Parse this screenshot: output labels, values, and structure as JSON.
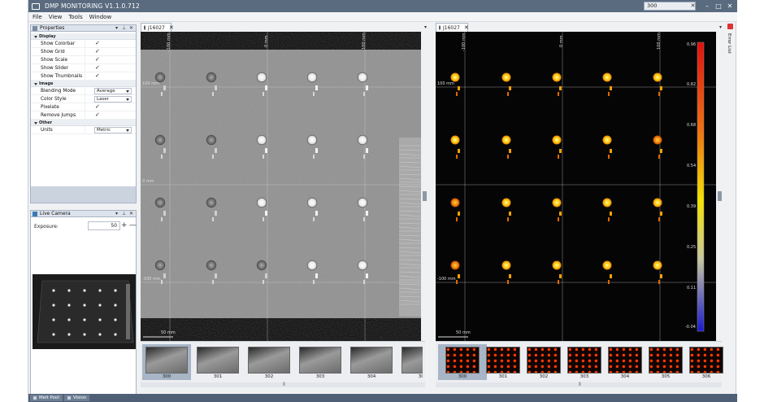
{
  "app": {
    "title": "DMP MONITORING V1.1.0.712",
    "search_value": "300",
    "search_clear": "✕",
    "minimize": "–",
    "maximize": "□",
    "close": "✕"
  },
  "menu": [
    "File",
    "View",
    "Tools",
    "Window"
  ],
  "properties": {
    "title": "Properties",
    "categories": {
      "display": "Display",
      "image": "Image",
      "other": "Other"
    },
    "display_rows": [
      {
        "label": "Show Colorbar",
        "checked": "✓"
      },
      {
        "label": "Show Grid",
        "checked": "✓"
      },
      {
        "label": "Show Scale",
        "checked": "✓"
      },
      {
        "label": "Show Slider",
        "checked": "✓"
      },
      {
        "label": "Show Thumbnails",
        "checked": "✓"
      }
    ],
    "image_rows": {
      "blending_label": "Blending Mode",
      "blending_value": "Average",
      "color_label": "Color Style",
      "color_value": "Laser",
      "pixelate_label": "Pixelate",
      "pixelate_checked": "✓",
      "jumps_label": "Remove Jumps",
      "jumps_checked": "✓"
    },
    "other_rows": {
      "units_label": "Units",
      "units_value": "Metric"
    }
  },
  "live_camera": {
    "title": "Live Camera",
    "exposure_label": "Exposure:",
    "exposure_value": "50",
    "plus": "+",
    "minus": "—"
  },
  "left_viewer": {
    "tab_label": "J16027",
    "top_ticks": [
      "-100 mm",
      "0 mm",
      "100 mm"
    ],
    "side_ticks": [
      "100 mm",
      "0 mm",
      "-100 mm"
    ],
    "scale_label": "50 mm",
    "thumbnails": [
      "300",
      "301",
      "302",
      "303",
      "304",
      "305"
    ],
    "selected_thumbnail": "300"
  },
  "right_viewer": {
    "tab_label": "J16027",
    "top_ticks": [
      "-100 mm",
      "0 mm",
      "100 mm"
    ],
    "side_ticks": [
      "100 mm",
      "0 mm",
      "-100 mm"
    ],
    "scale_label": "50 mm",
    "colorbar_ticks": [
      "0.96",
      "0.82",
      "0.68",
      "0.54",
      "0.39",
      "0.25",
      "0.11",
      "-0.04"
    ],
    "thumbnails": [
      "300",
      "301",
      "302",
      "303",
      "304",
      "305",
      "306"
    ],
    "selected_thumbnail": "300"
  },
  "side_panel": {
    "label": "Error List"
  },
  "status_tabs": [
    "Melt Pool",
    "Vision"
  ],
  "colors": {
    "titlebar": "#5a6b80",
    "panel_header": "#dde3ec",
    "selected_thumb": "#a7b5c6",
    "colorbar_top": "#e01010",
    "colorbar_mid": "#f5e400",
    "colorbar_bottom": "#1818d0"
  }
}
